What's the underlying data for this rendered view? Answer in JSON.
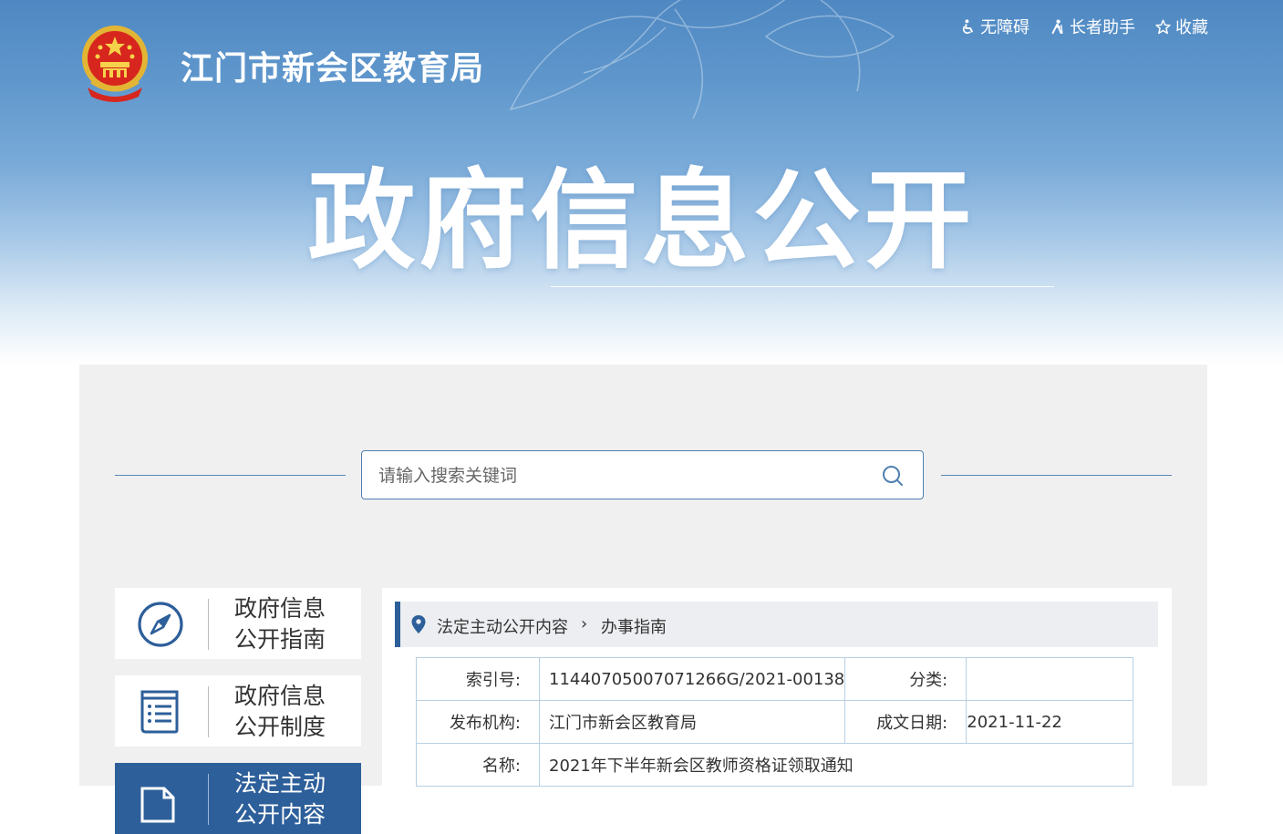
{
  "header": {
    "agency_name": "江门市新会区教育局",
    "hero_title": "政府信息公开",
    "links": [
      {
        "label": "无障碍",
        "icon": "accessibility-icon"
      },
      {
        "label": "长者助手",
        "icon": "elder-assistant-icon"
      },
      {
        "label": "收藏",
        "icon": "star-icon"
      }
    ]
  },
  "search": {
    "placeholder": "请输入搜索关键词",
    "icon": "search-icon"
  },
  "sidebar": {
    "items": [
      {
        "line1": "政府信息",
        "line2": "公开指南",
        "icon": "compass-icon"
      },
      {
        "line1": "政府信息",
        "line2": "公开制度",
        "icon": "list-document-icon"
      },
      {
        "line1": "法定主动",
        "line2": "公开内容",
        "icon": "document-icon",
        "active": true
      }
    ]
  },
  "breadcrumb": {
    "icon": "location-pin-icon",
    "items": [
      "法定主动公开内容",
      "办事指南"
    ],
    "separator": ">"
  },
  "info_table": {
    "index_label": "索引号:",
    "index_value": "11440705007071266G/2021-00138",
    "category_label": "分类:",
    "category_value": "",
    "publisher_label": "发布机构:",
    "publisher_value": "江门市新会区教育局",
    "date_label": "成文日期:",
    "date_value": "2021-11-22",
    "name_label": "名称:",
    "name_value": "2021年下半年新会区教师资格证领取通知"
  },
  "colors": {
    "primary": "#2d5f9a",
    "banner_top": "#4f88c2",
    "panel_bg": "#f0f0f0",
    "table_border": "#b7d0e4"
  }
}
